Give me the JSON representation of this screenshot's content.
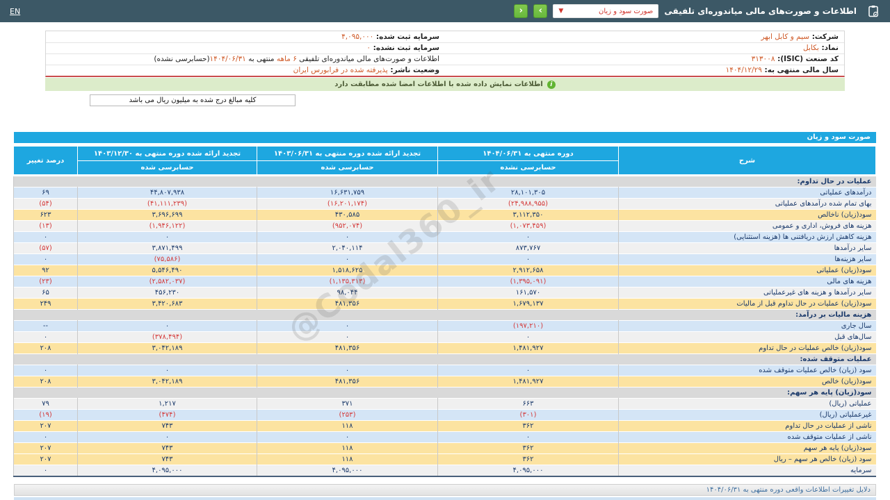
{
  "colors": {
    "topbar": "#3c5866",
    "accent": "#1ea7e0",
    "yellow-row": "#fce3a1",
    "blue-row": "#d4e5f6",
    "white-row": "#f0f0f0",
    "section-row": "#d9d9d9",
    "navy": "#1b3a6b",
    "red": "#d43a3a",
    "orange": "#cf5a28",
    "green-btn": "#67b83c",
    "banner-bg": "#dcecca",
    "banner-line": "#c94c4c"
  },
  "topbar": {
    "en_label": "EN",
    "title": "اطلاعات و صورت‌های مالی میاندوره‌ای تلفیقی",
    "dropdown_value": "صورت سود و زیان",
    "dropdown_caret": "▼",
    "next_button": "›",
    "prev_button": "‹"
  },
  "info_rows": [
    {
      "right": [
        {
          "t": "شرکت: ",
          "s": "label"
        },
        {
          "t": "سیم و کابل ابهر",
          "s": "value"
        }
      ],
      "left": [
        {
          "t": "سرمایه ثبت شده: ",
          "s": "label"
        },
        {
          "t": "۴,۰۹۵,۰۰۰",
          "s": "value"
        }
      ]
    },
    {
      "right": [
        {
          "t": "نماد: ",
          "s": "label"
        },
        {
          "t": "بکابل",
          "s": "value"
        }
      ],
      "left": [
        {
          "t": "سرمایه ثبت نشده: ",
          "s": "label"
        },
        {
          "t": "۰",
          "s": "value"
        }
      ]
    },
    {
      "right": [
        {
          "t": "کد صنعت (ISIC): ",
          "s": "label"
        },
        {
          "t": "۳۱۳۰۰۸",
          "s": "value"
        }
      ],
      "left": [
        {
          "t": "اطلاعات و صورت‌های مالی میاندوره‌ای تلفیقی ",
          "s": "plain"
        },
        {
          "t": "۶ ماهه",
          "s": "value"
        },
        {
          "t": " منتهی به ",
          "s": "plain"
        },
        {
          "t": "۱۴۰۴/۰۶/۳۱",
          "s": "value"
        },
        {
          "t": "(حسابرسی نشده)",
          "s": "plain"
        }
      ]
    },
    {
      "right": [
        {
          "t": "سال مالی منتهی به: ",
          "s": "label"
        },
        {
          "t": "۱۴۰۴/۱۲/۲۹",
          "s": "value"
        }
      ],
      "left": [
        {
          "t": "وضعیت ناشر: ",
          "s": "label"
        },
        {
          "t": "پذیرفته شده در فرابورس ایران",
          "s": "value"
        }
      ]
    }
  ],
  "banner": {
    "text": "اطلاعات نمایش داده شده با اطلاعات امضا شده مطابقت دارد"
  },
  "unit_note": "کلیه مبالغ درج شده به میلیون ریال می باشد",
  "watermark": "@Codal360_ir",
  "statement": {
    "title": "صورت سود و زیان",
    "columns": {
      "desc": "شرح",
      "current_top": "دوره منتهی به ۱۴۰۴/۰۶/۳۱",
      "current_bottom": "حسابرسی نشده",
      "prior_top": "تجدید ارائه شده دوره منتهی به ۱۴۰۳/۰۶/۳۱",
      "prior_bottom": "حسابرسی شده",
      "annual_top": "تجدید ارائه شده دوره منتهی به ۱۴۰۳/۱۲/۳۰",
      "annual_bottom": "حسابرسی شده",
      "change": "درصد تغییر"
    },
    "rows": [
      {
        "type": "section",
        "label": "عملیات در حال تداوم:"
      },
      {
        "type": "data",
        "shade": "blue",
        "label": "درآمدهای عملیاتی",
        "current": "۲۸,۱۰۱,۳۰۵",
        "prior": "۱۶,۶۳۱,۷۵۹",
        "annual": "۴۴,۸۰۷,۹۳۸",
        "change": "۶۹"
      },
      {
        "type": "data",
        "shade": "white",
        "label": "بهای تمام شده درآمدهای عملیاتی",
        "current": "(۲۴,۹۸۸,۹۵۵)",
        "prior": "(۱۶,۲۰۱,۱۷۴)",
        "annual": "(۴۱,۱۱۱,۲۳۹)",
        "change": "(۵۴)"
      },
      {
        "type": "data",
        "shade": "yellow",
        "label": "سود(زیان) ناخالص",
        "current": "۳,۱۱۲,۳۵۰",
        "prior": "۴۳۰,۵۸۵",
        "annual": "۳,۶۹۶,۶۹۹",
        "change": "۶۲۳"
      },
      {
        "type": "data",
        "shade": "white",
        "label": "هزینه های فروش، اداری و عمومی",
        "current": "(۱,۰۷۳,۴۵۹)",
        "prior": "(۹۵۲,۰۷۴)",
        "annual": "(۱,۹۴۶,۱۲۲)",
        "change": "(۱۳)"
      },
      {
        "type": "data",
        "shade": "blue",
        "label": "هزینه کاهش ارزش دریافتنی ها (هزینه استثنایی)",
        "current": "۰",
        "prior": "۰",
        "annual": "۰",
        "change": "۰"
      },
      {
        "type": "data",
        "shade": "white",
        "label": "سایر درآمدها",
        "current": "۸۷۳,۷۶۷",
        "prior": "۲,۰۴۰,۱۱۴",
        "annual": "۳,۸۷۱,۴۹۹",
        "change": "(۵۷)"
      },
      {
        "type": "data",
        "shade": "blue",
        "label": "سایر هزینه‌ها",
        "current": "۰",
        "prior": "۰",
        "annual": "(۷۵,۵۸۶)",
        "change": "۰"
      },
      {
        "type": "data",
        "shade": "yellow",
        "label": "سود(زیان) عملیاتی",
        "current": "۲,۹۱۲,۶۵۸",
        "prior": "۱,۵۱۸,۶۲۵",
        "annual": "۵,۵۴۶,۴۹۰",
        "change": "۹۲"
      },
      {
        "type": "data",
        "shade": "blue",
        "label": "هزینه های مالی",
        "current": "(۱,۳۹۵,۰۹۱)",
        "prior": "(۱,۱۳۵,۳۱۳)",
        "annual": "(۲,۵۸۲,۰۳۷)",
        "change": "(۲۳)"
      },
      {
        "type": "data",
        "shade": "white",
        "label": "سایر درآمدها و هزینه های غیرعملیاتی",
        "current": "۱۶۱,۵۷۰",
        "prior": "۹۸,۰۴۴",
        "annual": "۴۵۶,۲۳۰",
        "change": "۶۵"
      },
      {
        "type": "data",
        "shade": "yellow",
        "label": "سود(زیان) عملیات در حال تداوم قبل از مالیات",
        "current": "۱,۶۷۹,۱۳۷",
        "prior": "۴۸۱,۳۵۶",
        "annual": "۳,۴۲۰,۶۸۳",
        "change": "۲۴۹"
      },
      {
        "type": "section",
        "label": "هزینه مالیات بر درآمد:"
      },
      {
        "type": "data",
        "shade": "blue",
        "label": "سال جاری",
        "current": "(۱۹۷,۲۱۰)",
        "prior": "۰",
        "annual": "۰",
        "change": "--"
      },
      {
        "type": "data",
        "shade": "white",
        "label": "سال‌های قبل",
        "current": "۰",
        "prior": "۰",
        "annual": "(۳۷۸,۴۹۴)",
        "change": "۰"
      },
      {
        "type": "data",
        "shade": "yellow",
        "label": "سود(زیان) خالص عملیات در حال تداوم",
        "current": "۱,۴۸۱,۹۲۷",
        "prior": "۴۸۱,۳۵۶",
        "annual": "۳,۰۴۲,۱۸۹",
        "change": "۲۰۸"
      },
      {
        "type": "section",
        "label": "عملیات متوقف شده:"
      },
      {
        "type": "data",
        "shade": "blue",
        "label": "سود (زیان) خالص عملیات متوقف شده",
        "current": "۰",
        "prior": "۰",
        "annual": "۰",
        "change": "۰"
      },
      {
        "type": "data",
        "shade": "yellow",
        "label": "سود(زیان) خالص",
        "current": "۱,۴۸۱,۹۲۷",
        "prior": "۴۸۱,۳۵۶",
        "annual": "۳,۰۴۲,۱۸۹",
        "change": "۲۰۸"
      },
      {
        "type": "section",
        "label": "سود(زیان) پایه هر سهم:"
      },
      {
        "type": "data",
        "shade": "white",
        "label": "عملیاتی (ریال)",
        "current": "۶۶۳",
        "prior": "۳۷۱",
        "annual": "۱,۲۱۷",
        "change": "۷۹"
      },
      {
        "type": "data",
        "shade": "blue",
        "label": "غیرعملیاتی (ریال)",
        "current": "(۳۰۱)",
        "prior": "(۲۵۳)",
        "annual": "(۴۷۴)",
        "change": "(۱۹)"
      },
      {
        "type": "data",
        "shade": "yellow",
        "label": "ناشی از عملیات در حال تداوم",
        "current": "۳۶۲",
        "prior": "۱۱۸",
        "annual": "۷۴۳",
        "change": "۲۰۷"
      },
      {
        "type": "data",
        "shade": "blue",
        "label": "ناشی از عملیات متوقف شده",
        "current": "۰",
        "prior": "۰",
        "annual": "۰",
        "change": "۰"
      },
      {
        "type": "data",
        "shade": "yellow",
        "label": "سود(زیان) پایه هر سهم",
        "current": "۳۶۲",
        "prior": "۱۱۸",
        "annual": "۷۴۳",
        "change": "۲۰۷"
      },
      {
        "type": "data",
        "shade": "yellow",
        "label": "سود (زیان) خالص هر سهم – ریال",
        "current": "۳۶۲",
        "prior": "۱۱۸",
        "annual": "۷۴۳",
        "change": "۲۰۷"
      },
      {
        "type": "data",
        "shade": "white",
        "label": "سرمایه",
        "current": "۴,۰۹۵,۰۰۰",
        "prior": "۴,۰۹۵,۰۰۰",
        "annual": "۴,۰۹۵,۰۰۰",
        "change": "۰"
      }
    ]
  },
  "footer": {
    "accordion_label": "دلایل تغییرات اطلاعات واقعی دوره منتهی به ۱۴۰۴/۰۶/۳۱"
  }
}
